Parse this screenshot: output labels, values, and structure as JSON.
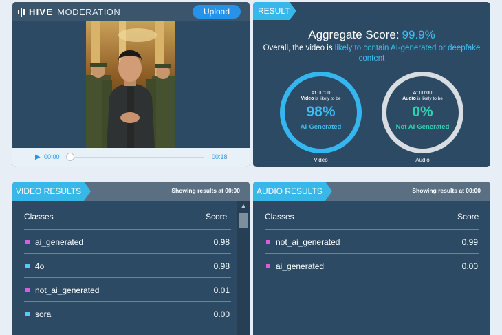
{
  "app": {
    "brand_bold": "HIVE",
    "brand_rest": "MODERATION",
    "upload_label": "Upload"
  },
  "player": {
    "current_time": "00:00",
    "duration": "00:18",
    "progress": 0
  },
  "result": {
    "tag": "RESULT",
    "aggregate_label": "Aggregate Score:",
    "aggregate_value": "99.9%",
    "overall_prefix": "Overall, the video is",
    "overall_highlight": "likely to contain AI-generated or deepfake content",
    "video": {
      "at": "At 00:00",
      "likely_bold": "Video",
      "likely_rest": "is likely to be",
      "percent": "98%",
      "label": "AI-Generated",
      "caption": "Video",
      "color": "#36b6ef"
    },
    "audio": {
      "at": "At 00:00",
      "likely_bold": "Audio",
      "likely_rest": "is likely to be",
      "percent": "0%",
      "label": "Not AI-Generated",
      "caption": "Audio",
      "color": "#d8dde2"
    }
  },
  "video_results": {
    "tag": "VIDEO RESULTS",
    "showing": "Showing results at 00:00",
    "col_classes": "Classes",
    "col_score": "Score",
    "rows": [
      {
        "name": "ai_generated",
        "score": "0.98",
        "color": "#e05bd8"
      },
      {
        "name": "4o",
        "score": "0.98",
        "color": "#4fd0ec"
      },
      {
        "name": "not_ai_generated",
        "score": "0.01",
        "color": "#e05bd8"
      },
      {
        "name": "sora",
        "score": "0.00",
        "color": "#4fd0ec"
      }
    ]
  },
  "audio_results": {
    "tag": "AUDIO RESULTS",
    "showing": "Showing results at 00:00",
    "col_classes": "Classes",
    "col_score": "Score",
    "rows": [
      {
        "name": "not_ai_generated",
        "score": "0.99",
        "color": "#e05bd8"
      },
      {
        "name": "ai_generated",
        "score": "0.00",
        "color": "#e05bd8"
      }
    ]
  }
}
